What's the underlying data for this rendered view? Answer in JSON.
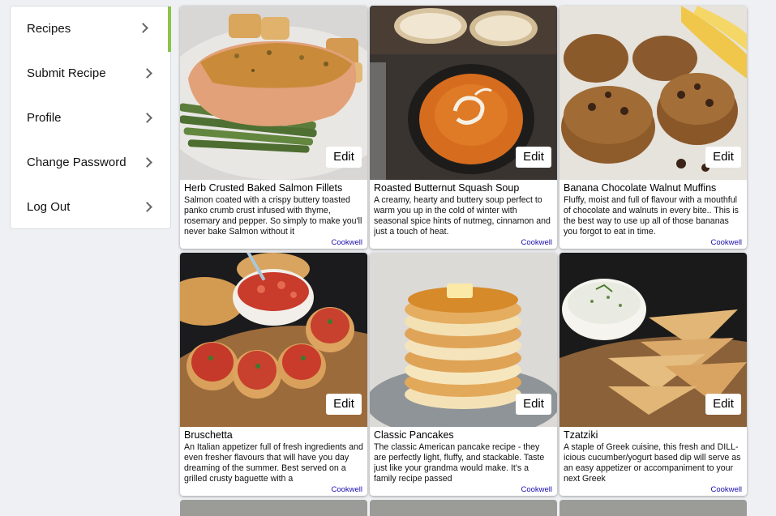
{
  "sidebar": {
    "items": [
      {
        "label": "Recipes"
      },
      {
        "label": "Submit Recipe"
      },
      {
        "label": "Profile"
      },
      {
        "label": "Change Password"
      },
      {
        "label": "Log Out"
      }
    ],
    "active_color": "#8bc34a"
  },
  "recipes": [
    {
      "title": "Herb Crusted Baked Salmon Fillets",
      "description": "Salmon coated with a crispy buttery toasted panko crumb crust infused with thyme, rosemary and pepper. So simply to make you'll never bake Salmon without it",
      "source": "Cookwell",
      "edit_label": "Edit"
    },
    {
      "title": "Roasted Butternut Squash Soup",
      "description": "A creamy, hearty and buttery soup perfect to warm you up in the cold of winter with seasonal spice hints of nutmeg, cinnamon and just a touch of heat.",
      "source": "Cookwell",
      "edit_label": "Edit"
    },
    {
      "title": "Banana Chocolate Walnut Muffins",
      "description": "Fluffy, moist and full of flavour with a mouthful of chocolate and walnuts in every bite.. This is the best way to use up all of those bananas you forgot to eat in time.",
      "source": "Cookwell",
      "edit_label": "Edit"
    },
    {
      "title": "Bruschetta",
      "description": "An Italian appetizer full of fresh ingredients and even fresher flavours that will have you day dreaming of the summer. Best served on a grilled crusty baguette with a",
      "source": "Cookwell",
      "edit_label": "Edit"
    },
    {
      "title": "Classic Pancakes",
      "description": "The classic American pancake recipe - they are perfectly light, fluffy, and stackable. Taste just like your grandma would make. It's a family recipe passed",
      "source": "Cookwell",
      "edit_label": "Edit"
    },
    {
      "title": "Tzatziki",
      "description": "A staple of Greek cuisine, this fresh and DILL-icious cucumber/yogurt based dip will serve as an easy appetizer or accompaniment to your next Greek",
      "source": "Cookwell",
      "edit_label": "Edit"
    }
  ]
}
